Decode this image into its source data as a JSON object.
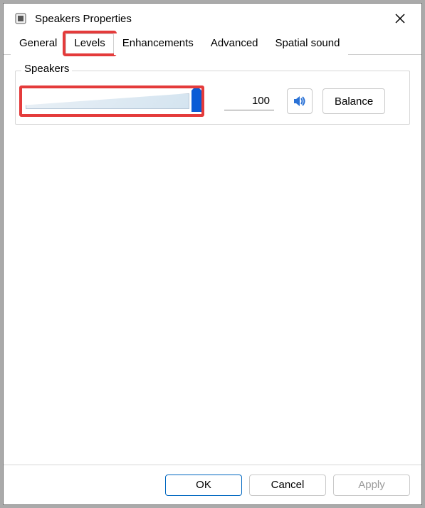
{
  "window": {
    "title": "Speakers Properties"
  },
  "tabs": {
    "general": "General",
    "levels": "Levels",
    "enhancements": "Enhancements",
    "advanced": "Advanced",
    "spatial": "Spatial sound",
    "active": "levels"
  },
  "group": {
    "label": "Speakers",
    "slider_value": "100",
    "balance_label": "Balance"
  },
  "buttons": {
    "ok": "OK",
    "cancel": "Cancel",
    "apply": "Apply"
  },
  "colors": {
    "highlight": "#e43b3b",
    "accent": "#0067c0",
    "thumb": "#0a5bd6"
  }
}
